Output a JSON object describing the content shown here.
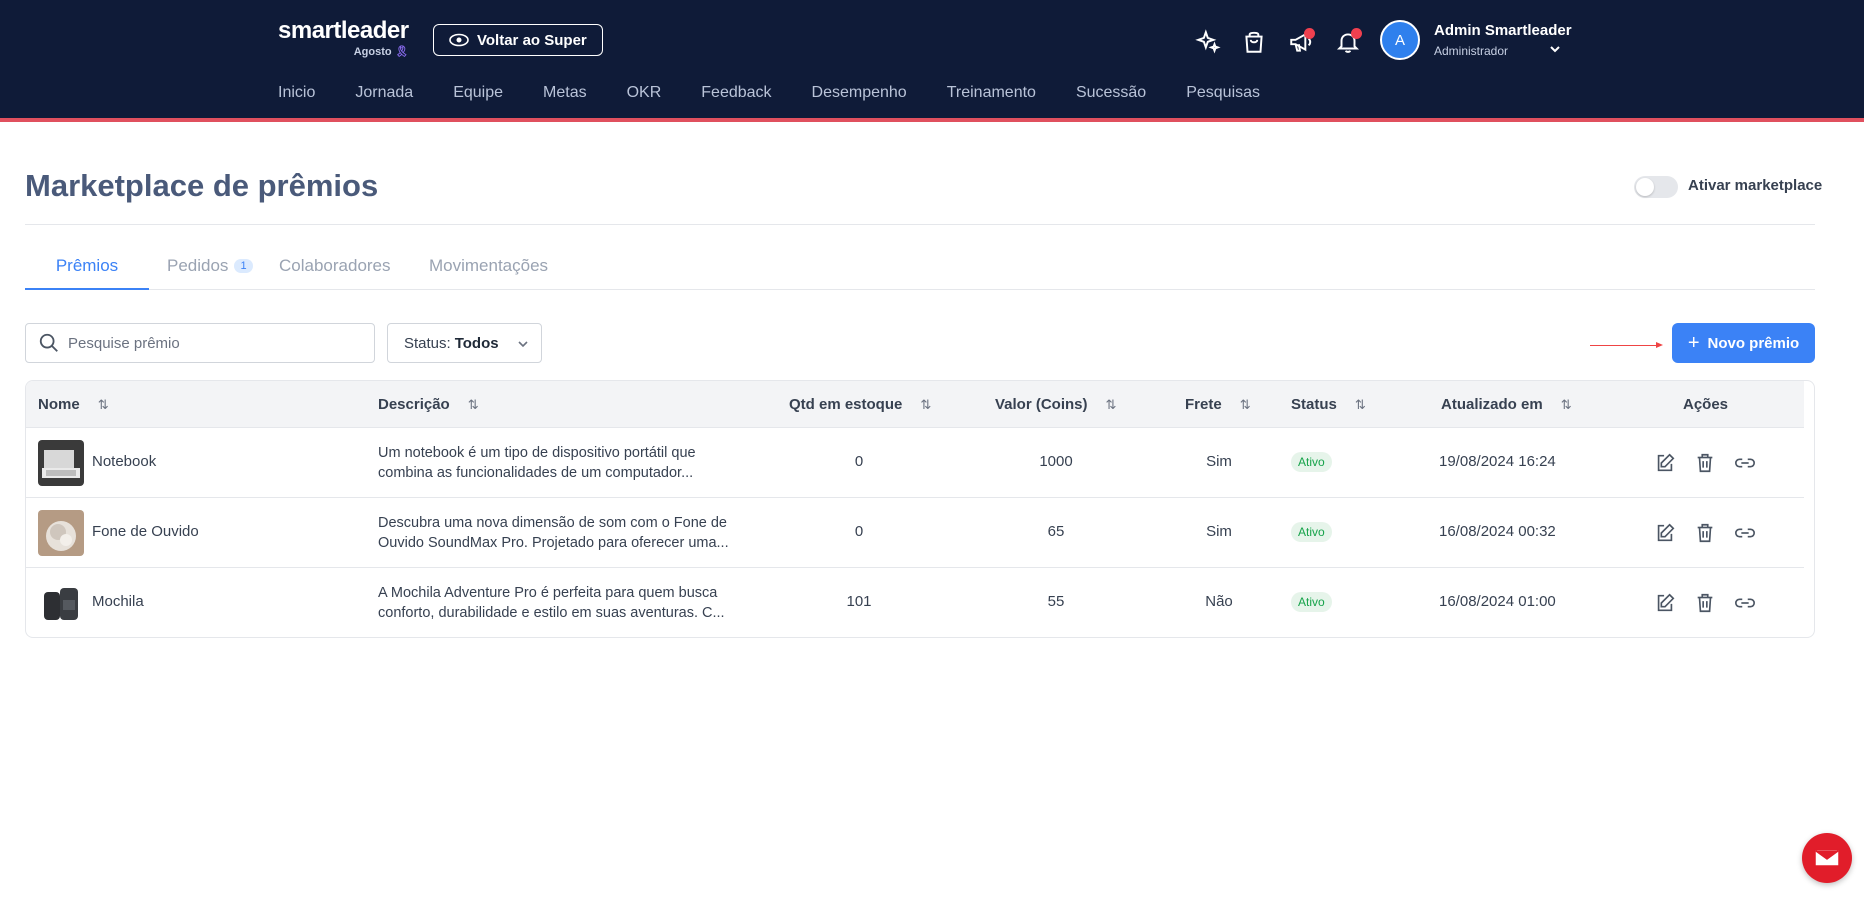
{
  "header": {
    "brand": "smartleader",
    "month": "Agosto",
    "super_button": "Voltar ao Super",
    "nav": [
      "Inicio",
      "Jornada",
      "Equipe",
      "Metas",
      "OKR",
      "Feedback",
      "Desempenho",
      "Treinamento",
      "Sucessão",
      "Pesquisas"
    ],
    "user": {
      "initial": "A",
      "name": "Admin Smartleader",
      "role": "Administrador"
    },
    "icons": [
      "sparkles-icon",
      "shopping-bag-icon",
      "megaphone-icon",
      "bell-icon"
    ],
    "accent_line_color": "#e0505e",
    "bg_color": "#0f1b38"
  },
  "page": {
    "title": "Marketplace de prêmios",
    "toggle_label": "Ativar marketplace",
    "toggle_on": false
  },
  "tabs": [
    {
      "label": "Prêmios",
      "active": true
    },
    {
      "label": "Pedidos",
      "badge": "1"
    },
    {
      "label": "Colaboradores"
    },
    {
      "label": "Movimentações"
    }
  ],
  "filters": {
    "search_placeholder": "Pesquise prêmio",
    "status_label": "Status:",
    "status_value": "Todos",
    "new_button": "Novo prêmio"
  },
  "table": {
    "columns": [
      "Nome",
      "Descrição",
      "Qtd em estoque",
      "Valor (Coins)",
      "Frete",
      "Status",
      "Atualizado em",
      "Ações"
    ],
    "rows": [
      {
        "name": "Notebook",
        "desc1": "Um notebook é um tipo de dispositivo portátil que",
        "desc2": "combina as funcionalidades de um computador...",
        "stock": "0",
        "value": "1000",
        "shipping": "Sim",
        "status": "Ativo",
        "updated": "19/08/2024 16:24"
      },
      {
        "name": "Fone de Ouvido",
        "desc1": "Descubra uma nova dimensão de som com o Fone de",
        "desc2": "Ouvido SoundMax Pro. Projetado para oferecer uma...",
        "stock": "0",
        "value": "65",
        "shipping": "Sim",
        "status": "Ativo",
        "updated": "16/08/2024 00:32"
      },
      {
        "name": "Mochila",
        "desc1": "A Mochila Adventure Pro é perfeita para quem busca",
        "desc2": "conforto, durabilidade e estilo em suas aventuras. C...",
        "stock": "101",
        "value": "55",
        "shipping": "Não",
        "status": "Ativo",
        "updated": "16/08/2024 01:00"
      }
    ]
  }
}
